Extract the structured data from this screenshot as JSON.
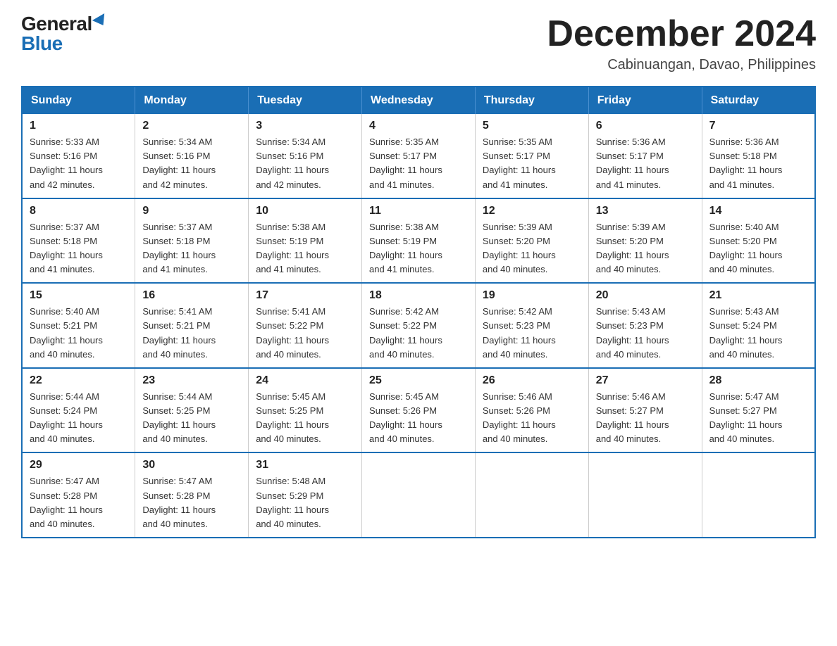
{
  "logo": {
    "general": "General",
    "blue": "Blue"
  },
  "title": {
    "month_year": "December 2024",
    "location": "Cabinuangan, Davao, Philippines"
  },
  "headers": [
    "Sunday",
    "Monday",
    "Tuesday",
    "Wednesday",
    "Thursday",
    "Friday",
    "Saturday"
  ],
  "weeks": [
    [
      {
        "day": "1",
        "sunrise": "5:33 AM",
        "sunset": "5:16 PM",
        "daylight": "11 hours and 42 minutes."
      },
      {
        "day": "2",
        "sunrise": "5:34 AM",
        "sunset": "5:16 PM",
        "daylight": "11 hours and 42 minutes."
      },
      {
        "day": "3",
        "sunrise": "5:34 AM",
        "sunset": "5:16 PM",
        "daylight": "11 hours and 42 minutes."
      },
      {
        "day": "4",
        "sunrise": "5:35 AM",
        "sunset": "5:17 PM",
        "daylight": "11 hours and 41 minutes."
      },
      {
        "day": "5",
        "sunrise": "5:35 AM",
        "sunset": "5:17 PM",
        "daylight": "11 hours and 41 minutes."
      },
      {
        "day": "6",
        "sunrise": "5:36 AM",
        "sunset": "5:17 PM",
        "daylight": "11 hours and 41 minutes."
      },
      {
        "day": "7",
        "sunrise": "5:36 AM",
        "sunset": "5:18 PM",
        "daylight": "11 hours and 41 minutes."
      }
    ],
    [
      {
        "day": "8",
        "sunrise": "5:37 AM",
        "sunset": "5:18 PM",
        "daylight": "11 hours and 41 minutes."
      },
      {
        "day": "9",
        "sunrise": "5:37 AM",
        "sunset": "5:18 PM",
        "daylight": "11 hours and 41 minutes."
      },
      {
        "day": "10",
        "sunrise": "5:38 AM",
        "sunset": "5:19 PM",
        "daylight": "11 hours and 41 minutes."
      },
      {
        "day": "11",
        "sunrise": "5:38 AM",
        "sunset": "5:19 PM",
        "daylight": "11 hours and 41 minutes."
      },
      {
        "day": "12",
        "sunrise": "5:39 AM",
        "sunset": "5:20 PM",
        "daylight": "11 hours and 40 minutes."
      },
      {
        "day": "13",
        "sunrise": "5:39 AM",
        "sunset": "5:20 PM",
        "daylight": "11 hours and 40 minutes."
      },
      {
        "day": "14",
        "sunrise": "5:40 AM",
        "sunset": "5:20 PM",
        "daylight": "11 hours and 40 minutes."
      }
    ],
    [
      {
        "day": "15",
        "sunrise": "5:40 AM",
        "sunset": "5:21 PM",
        "daylight": "11 hours and 40 minutes."
      },
      {
        "day": "16",
        "sunrise": "5:41 AM",
        "sunset": "5:21 PM",
        "daylight": "11 hours and 40 minutes."
      },
      {
        "day": "17",
        "sunrise": "5:41 AM",
        "sunset": "5:22 PM",
        "daylight": "11 hours and 40 minutes."
      },
      {
        "day": "18",
        "sunrise": "5:42 AM",
        "sunset": "5:22 PM",
        "daylight": "11 hours and 40 minutes."
      },
      {
        "day": "19",
        "sunrise": "5:42 AM",
        "sunset": "5:23 PM",
        "daylight": "11 hours and 40 minutes."
      },
      {
        "day": "20",
        "sunrise": "5:43 AM",
        "sunset": "5:23 PM",
        "daylight": "11 hours and 40 minutes."
      },
      {
        "day": "21",
        "sunrise": "5:43 AM",
        "sunset": "5:24 PM",
        "daylight": "11 hours and 40 minutes."
      }
    ],
    [
      {
        "day": "22",
        "sunrise": "5:44 AM",
        "sunset": "5:24 PM",
        "daylight": "11 hours and 40 minutes."
      },
      {
        "day": "23",
        "sunrise": "5:44 AM",
        "sunset": "5:25 PM",
        "daylight": "11 hours and 40 minutes."
      },
      {
        "day": "24",
        "sunrise": "5:45 AM",
        "sunset": "5:25 PM",
        "daylight": "11 hours and 40 minutes."
      },
      {
        "day": "25",
        "sunrise": "5:45 AM",
        "sunset": "5:26 PM",
        "daylight": "11 hours and 40 minutes."
      },
      {
        "day": "26",
        "sunrise": "5:46 AM",
        "sunset": "5:26 PM",
        "daylight": "11 hours and 40 minutes."
      },
      {
        "day": "27",
        "sunrise": "5:46 AM",
        "sunset": "5:27 PM",
        "daylight": "11 hours and 40 minutes."
      },
      {
        "day": "28",
        "sunrise": "5:47 AM",
        "sunset": "5:27 PM",
        "daylight": "11 hours and 40 minutes."
      }
    ],
    [
      {
        "day": "29",
        "sunrise": "5:47 AM",
        "sunset": "5:28 PM",
        "daylight": "11 hours and 40 minutes."
      },
      {
        "day": "30",
        "sunrise": "5:47 AM",
        "sunset": "5:28 PM",
        "daylight": "11 hours and 40 minutes."
      },
      {
        "day": "31",
        "sunrise": "5:48 AM",
        "sunset": "5:29 PM",
        "daylight": "11 hours and 40 minutes."
      },
      null,
      null,
      null,
      null
    ]
  ],
  "labels": {
    "sunrise": "Sunrise:",
    "sunset": "Sunset:",
    "daylight": "Daylight:"
  }
}
